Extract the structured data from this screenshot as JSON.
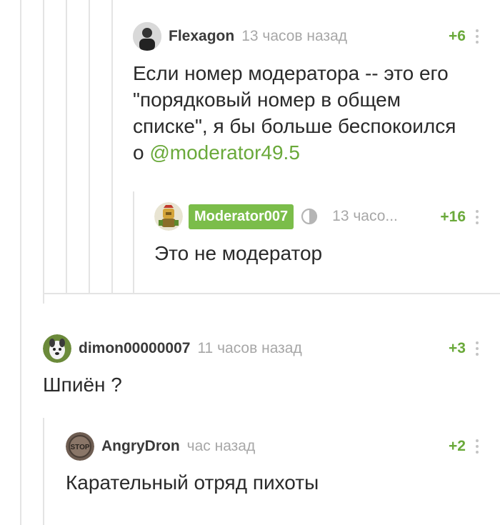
{
  "comments": [
    {
      "username": "Flexagon",
      "time": "13 часов назад",
      "rating": "+6",
      "text_lines": [
        "Если номер модератора -- это его",
        "\"порядковый номер в общем",
        "списке\", я бы больше беспокоился"
      ],
      "text_last_prefix": "о ",
      "mention": "@moderator49.5"
    },
    {
      "username": "Moderator007",
      "time": "13 часо...",
      "rating": "+16",
      "text": "Это не модератор"
    },
    {
      "username": "dimon00000007",
      "time": "11 часов назад",
      "rating": "+3",
      "text": "Шпиён ?"
    },
    {
      "username": "AngryDron",
      "time": "час назад",
      "rating": "+2",
      "text": "Карательный отряд пихоты",
      "avatar_text": "STOP"
    }
  ],
  "colors": {
    "accent_green": "#6aa93a",
    "badge_green": "#7bbd4a",
    "meta_gray": "#a7a7a7",
    "thread_line": "#e4e4e4"
  },
  "icons": [
    "more-vertical-icon",
    "moderator-shield-icon"
  ]
}
